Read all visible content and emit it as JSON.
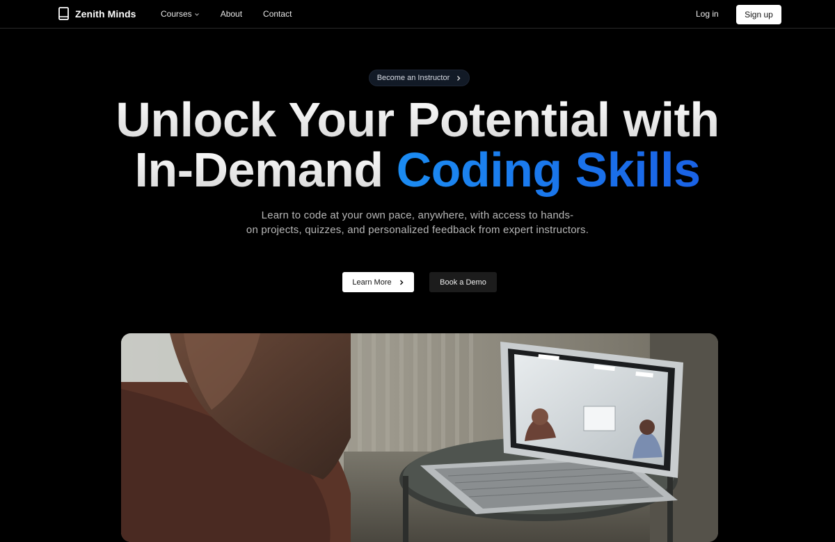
{
  "nav": {
    "brand": "Zenith Minds",
    "brand_icon": "book-icon",
    "links": [
      "Courses",
      "About",
      "Contact"
    ],
    "courses_icon": "chevron-down-icon",
    "login": "Log in",
    "signup": "Sign up"
  },
  "hero": {
    "pill_label": "Become an Instructor",
    "pill_icon": "chevron-right-icon",
    "headline_line1": "Unlock Your Potential with",
    "headline_line2_plain": "In-Demand ",
    "headline_line2_accent": "Coding Skills",
    "subtext_line1": "Learn to code at your own pace, anywhere, with access to hands-",
    "subtext_line2": "on projects, quizzes, and personalized feedback from expert instructors.",
    "learn_more": "Learn More",
    "book_demo": "Book a Demo",
    "accent_color": "#1a7ef0"
  },
  "image": {
    "subject": "person-watching-laptop-video-call"
  }
}
